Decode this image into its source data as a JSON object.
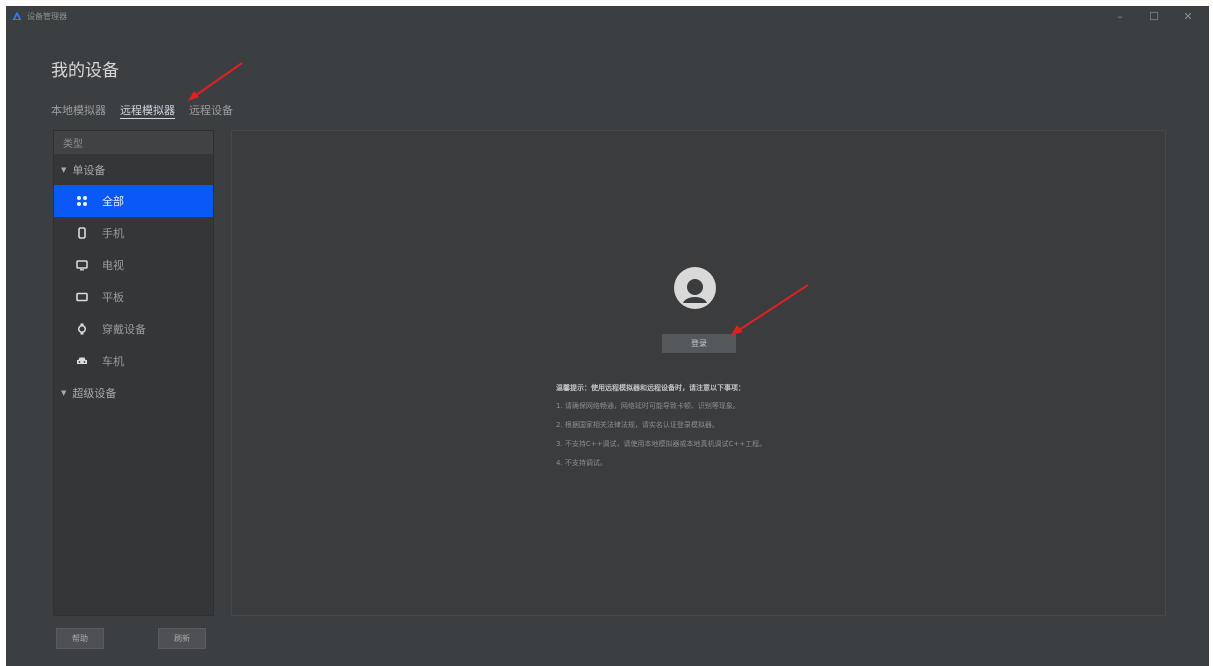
{
  "window": {
    "title": "设备管理器"
  },
  "controls": {
    "minimize": "–",
    "maximize": "☐",
    "close": "✕"
  },
  "page_title": "我的设备",
  "tabs": [
    {
      "label": "本地模拟器",
      "active": false
    },
    {
      "label": "远程模拟器",
      "active": true
    },
    {
      "label": "远程设备",
      "active": false
    }
  ],
  "sidebar": {
    "header": "类型",
    "group_single": "单设备",
    "items": [
      {
        "label": "全部",
        "icon": "grid-icon",
        "active": true
      },
      {
        "label": "手机",
        "icon": "phone-icon",
        "active": false
      },
      {
        "label": "电视",
        "icon": "tv-icon",
        "active": false
      },
      {
        "label": "平板",
        "icon": "tablet-icon",
        "active": false
      },
      {
        "label": "穿戴设备",
        "icon": "watch-icon",
        "active": false
      },
      {
        "label": "车机",
        "icon": "car-icon",
        "active": false
      }
    ],
    "group_super": "超级设备"
  },
  "main": {
    "login_button": "登录",
    "notice_title": "温馨提示：使用远程模拟器和远程设备时，请注意以下事项：",
    "notice_lines": [
      "1. 请确保网络畅通，网络延时可能导致卡顿、识别等现象。",
      "2. 根据国家相关法律法规，请实名认证登录模拟器。",
      "3. 不支持C++调试，请使用本地模拟器或本地真机调试C++工程。",
      "4. 不支持调试。"
    ]
  },
  "footer": {
    "help_label": "帮助",
    "refresh_label": "刷新"
  },
  "colors": {
    "accent": "#0a59f7",
    "background": "#3c3f41",
    "annotation": "#e02020"
  }
}
